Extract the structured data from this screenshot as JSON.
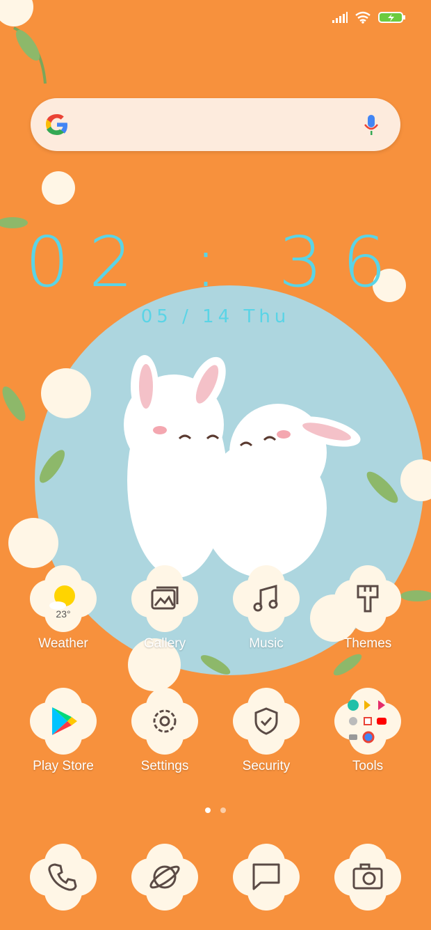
{
  "status_bar": {
    "battery_icon": "battery-charging-icon",
    "wifi_icon": "wifi-icon",
    "signal_icon": "signal-icon"
  },
  "search": {
    "mic_icon": "mic-icon",
    "google_icon": "google-logo"
  },
  "clock": {
    "time": "02 : 36",
    "date": "05 / 14   Thu"
  },
  "apps_row1": [
    {
      "label": "Weather",
      "temp": "23°",
      "icon": "weather-icon"
    },
    {
      "label": "Gallery",
      "icon": "gallery-icon"
    },
    {
      "label": "Music",
      "icon": "music-icon"
    },
    {
      "label": "Themes",
      "icon": "themes-icon"
    }
  ],
  "apps_row2": [
    {
      "label": "Play Store",
      "icon": "play-store-icon"
    },
    {
      "label": "Settings",
      "icon": "settings-icon"
    },
    {
      "label": "Security",
      "icon": "security-icon"
    },
    {
      "label": "Tools",
      "icon": "tools-folder-icon"
    }
  ],
  "dock": [
    {
      "icon": "phone-icon"
    },
    {
      "icon": "browser-icon"
    },
    {
      "icon": "messages-icon"
    },
    {
      "icon": "camera-icon"
    }
  ],
  "pager": {
    "pages": 2,
    "current": 1
  },
  "colors": {
    "background": "#F7913D",
    "clock": "#5AD4E6",
    "circle": "#ADD6DF",
    "bloom": "#FFF6E6"
  }
}
